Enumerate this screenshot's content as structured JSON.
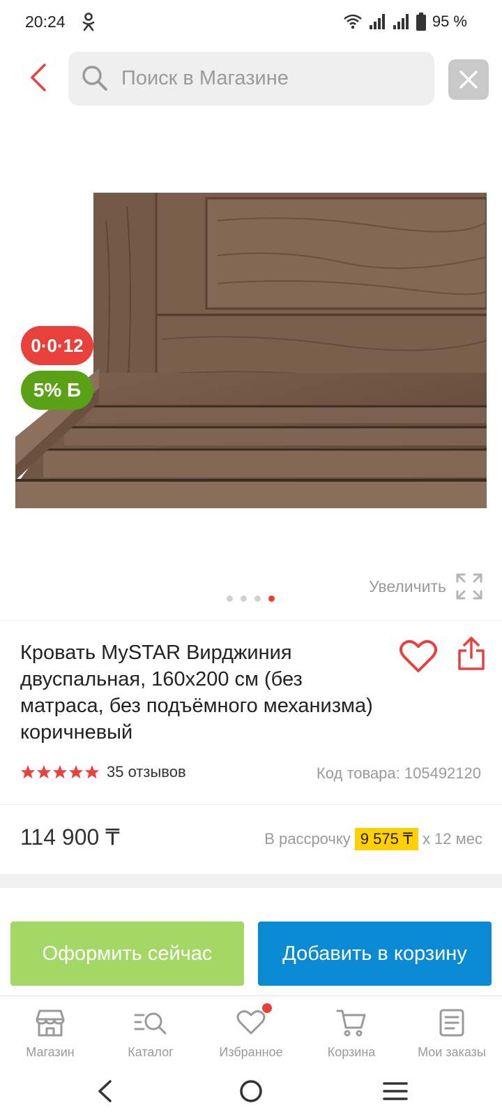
{
  "status_bar": {
    "time": "20:24",
    "battery": "95 %",
    "icons": [
      "odnoklassniki-icon",
      "wifi-icon",
      "signal-icon",
      "signal-icon",
      "battery-icon"
    ]
  },
  "search": {
    "placeholder": "Поиск в Магазине",
    "value": ""
  },
  "gallery": {
    "badge_installment": "0·0·12",
    "badge_bonus": "5% Б",
    "zoom_label": "Увеличить",
    "dots_count": 4,
    "active_dot": 4
  },
  "product": {
    "title": "Кровать MySTAR Вирджиния двуспальная, 160x200 см (без матраса, без подъёмного механизма) коричневый",
    "rating": 5,
    "reviews": "35 отзывов",
    "sku": "Код товара: 105492120",
    "price": "114 900 ₸",
    "installment_prefix": "В рассрочку",
    "installment_amount": "9 575 ₸",
    "installment_suffix": "x 12 мес"
  },
  "actions": {
    "buy_now": "Оформить сейчас",
    "add_to_cart": "Добавить в корзину"
  },
  "bottom_nav": [
    {
      "label": "Магазин",
      "icon": "store-icon"
    },
    {
      "label": "Каталог",
      "icon": "catalog-icon"
    },
    {
      "label": "Избранное",
      "icon": "heart-icon",
      "badge": true
    },
    {
      "label": "Корзина",
      "icon": "cart-icon"
    },
    {
      "label": "Мои заказы",
      "icon": "orders-icon"
    }
  ],
  "colors": {
    "accent_red": "#e8403b",
    "green_bonus": "#5aa116",
    "buy_now_bg": "#a4d866",
    "add_to_cart_bg": "#0a8ad2",
    "installment_highlight": "#ffd000"
  }
}
